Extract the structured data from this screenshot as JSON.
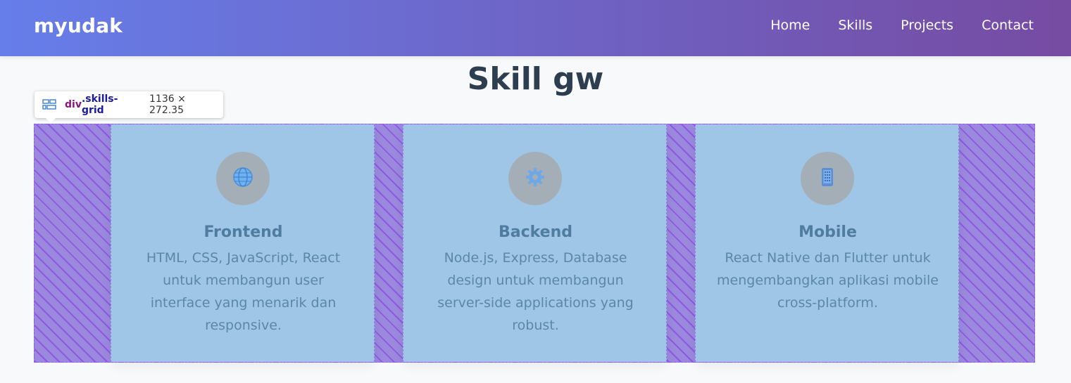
{
  "header": {
    "logo": "myudak",
    "nav": [
      "Home",
      "Skills",
      "Projects",
      "Contact"
    ]
  },
  "section": {
    "title": "Skill gw"
  },
  "inspector": {
    "icon": "grid-layout-icon",
    "tag": "div",
    "class": ".skills-grid",
    "size": "1136 × 272.35"
  },
  "skills": [
    {
      "icon": "globe-icon",
      "title": "Frontend",
      "desc": "HTML, CSS, JavaScript, React untuk membangun user interface yang menarik dan responsive."
    },
    {
      "icon": "gear-icon",
      "title": "Backend",
      "desc": "Node.js, Express, Database design untuk membangun server-side applications yang robust."
    },
    {
      "icon": "mobile-phone-icon",
      "title": "Mobile",
      "desc": "React Native dan Flutter untuk mengembangkan aplikasi mobile cross-platform."
    }
  ],
  "colors": {
    "header_gradient_start": "#667eea",
    "header_gradient_end": "#764ba2",
    "grid_overlay": "#9b59f0",
    "card_overlay": "#a0c6e7"
  }
}
